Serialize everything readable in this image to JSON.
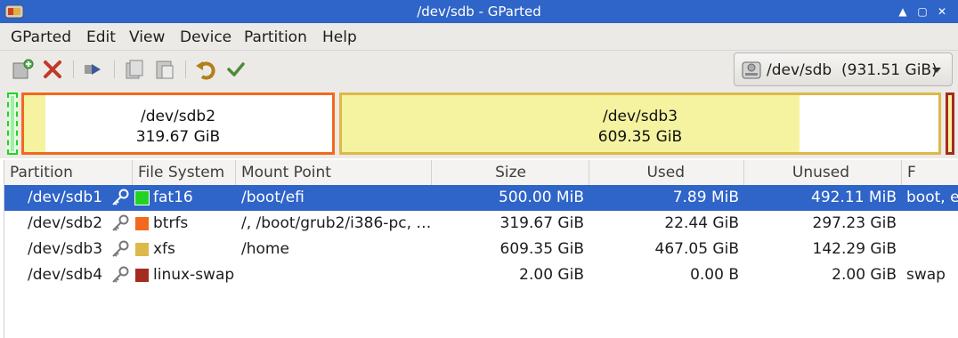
{
  "window": {
    "title": "/dev/sdb - GParted"
  },
  "menu": [
    "GParted",
    "Edit",
    "View",
    "Device",
    "Partition",
    "Help"
  ],
  "toolbar": {
    "icons": [
      "new-partition-icon",
      "delete-partition-icon",
      "resize-move-icon",
      "copy-icon",
      "paste-icon",
      "undo-icon",
      "apply-icon"
    ],
    "device_selector": "/dev/sdb  (931.51 GiB)"
  },
  "map": {
    "sdb2": {
      "name": "/dev/sdb2",
      "size": "319.67 GiB",
      "used_fraction": 0.07
    },
    "sdb3": {
      "name": "/dev/sdb3",
      "size": "609.35 GiB",
      "used_fraction": 0.767
    }
  },
  "table": {
    "headers": [
      "Partition",
      "File System",
      "Mount Point",
      "Size",
      "Used",
      "Unused",
      "F"
    ],
    "rows": [
      {
        "partition": "/dev/sdb1",
        "fs": "fat16",
        "fs_color": "#22d322",
        "mount": "/boot/efi",
        "size": "500.00 MiB",
        "used": "7.89 MiB",
        "unused": "492.11 MiB",
        "flags": "boot, e",
        "selected": true
      },
      {
        "partition": "/dev/sdb2",
        "fs": "btrfs",
        "fs_color": "#f2691e",
        "mount": "/, /boot/grub2/i386-pc, …",
        "size": "319.67 GiB",
        "used": "22.44 GiB",
        "unused": "297.23 GiB",
        "flags": "",
        "selected": false
      },
      {
        "partition": "/dev/sdb3",
        "fs": "xfs",
        "fs_color": "#ddb84a",
        "mount": "/home",
        "size": "609.35 GiB",
        "used": "467.05 GiB",
        "unused": "142.29 GiB",
        "flags": "",
        "selected": false
      },
      {
        "partition": "/dev/sdb4",
        "fs": "linux-swap",
        "fs_color": "#a42c1f",
        "mount": "",
        "size": "2.00 GiB",
        "used": "0.00 B",
        "unused": "2.00 GiB",
        "flags": "swap",
        "selected": false
      }
    ]
  },
  "colors": {
    "selection": "#2f64c8",
    "titlebar": "#2f64c8",
    "used_fill": "#f5f3a0"
  }
}
